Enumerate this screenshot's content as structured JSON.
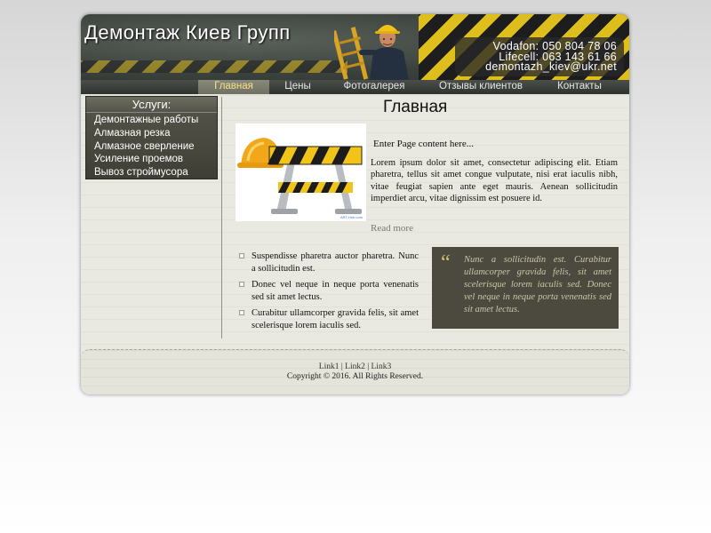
{
  "header": {
    "site_title": "Демонтаж Киев Групп",
    "contacts": {
      "vodafone": "Vodafon: 050 804 78 06",
      "lifecell": "Lifecell: 063 143 61 66",
      "email": "demontazh_kiev@ukr.net"
    }
  },
  "nav": {
    "items": [
      {
        "label": "Главная",
        "active": true
      },
      {
        "label": "Цены",
        "active": false
      },
      {
        "label": "Фотогалерея",
        "active": false
      },
      {
        "label": "Отзывы клиентов",
        "active": false
      },
      {
        "label": "Контакты",
        "active": false
      }
    ]
  },
  "sidebar": {
    "title": "Услуги:",
    "items": [
      {
        "label": "Демонтажные работы"
      },
      {
        "label": "Алмазная резка"
      },
      {
        "label": "Алмазное сверление"
      },
      {
        "label": "Усиление проемов"
      },
      {
        "label": "Вывоз строймусора"
      }
    ]
  },
  "main": {
    "title": "Главная",
    "intro": "Enter Page content here...",
    "lorem": "Lorem ipsum dolor sit amet, consectetur adipiscing elit. Etiam pharetra, tellus sit amet congue vulputate, nisi erat iaculis nibh, vitae feugiat sapien ante eget mauris. Aenean sollicitudin imperdiet arcu, vitae dignissim est posuere id.",
    "read_more": "Read more",
    "image_credit": "ART-Hub.com",
    "bullets": [
      {
        "text": "Suspendisse pharetra auctor pharetra. Nunc a sollicitudin est."
      },
      {
        "text": "Donec vel neque in neque porta venenatis sed sit amet lectus."
      },
      {
        "text": "Curabitur ullamcorper gravida felis, sit amet scelerisque lorem iaculis sed."
      }
    ],
    "quote": {
      "mark": "“",
      "text": "Nunc a sollicitudin est. Curabitur ullamcorper gravida felis, sit amet scelerisque lorem iaculis sed. Donec vel neque in neque porta venenatis sed sit amet lectus."
    }
  },
  "footer": {
    "links": [
      "Link1",
      "Link2",
      "Link3"
    ],
    "separator": " | ",
    "copyright": "Copyright © 2016. All Rights Reserved."
  },
  "colors": {
    "accent_yellow": "#e6c51a",
    "nav_active_text": "#f3e28a",
    "sidebar_bg": "#4b4a40",
    "quote_bg": "#4c4a3f"
  },
  "icons": {
    "hero": "road-barrier-with-hard-hat",
    "quote": "quote-mark-icon",
    "bullet": "square-bullet-icon"
  }
}
